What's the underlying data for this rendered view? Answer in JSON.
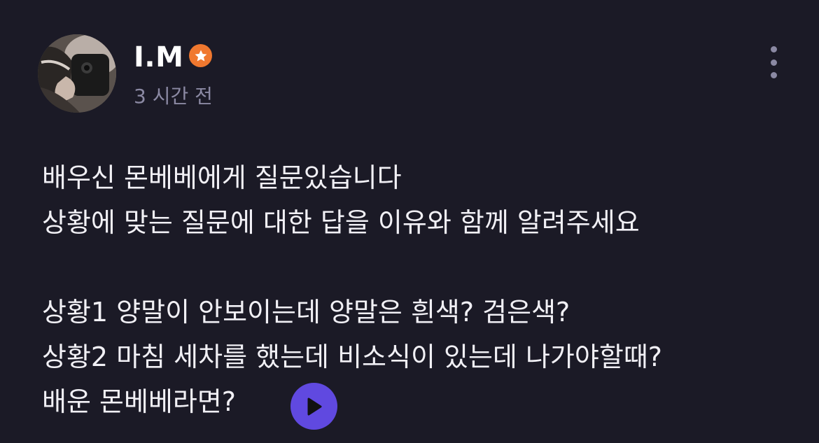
{
  "author": {
    "name": "I.M",
    "badge_icon": "star-badge-icon",
    "badge_color": "#f0782f",
    "posted_time": "3 시간 전"
  },
  "post": {
    "lines": [
      "배우신 몬베베에게 질문있습니다",
      "상황에 맞는 질문에 대한 답을 이유와 함께 알려주세요",
      "",
      "상황1 양말이 안보이는데 양말은 흰색? 검은색?",
      "상황2 마침 세차를 했는데 비소식이 있는데 나가야할때?",
      "배운 몬베베라면?"
    ]
  },
  "actions": {
    "more_icon": "more-vertical-icon",
    "play_icon": "play-icon",
    "play_color": "#6049e0"
  },
  "colors": {
    "background": "#1b1a26",
    "text": "#f1f0f5",
    "muted": "#8b89a3"
  }
}
